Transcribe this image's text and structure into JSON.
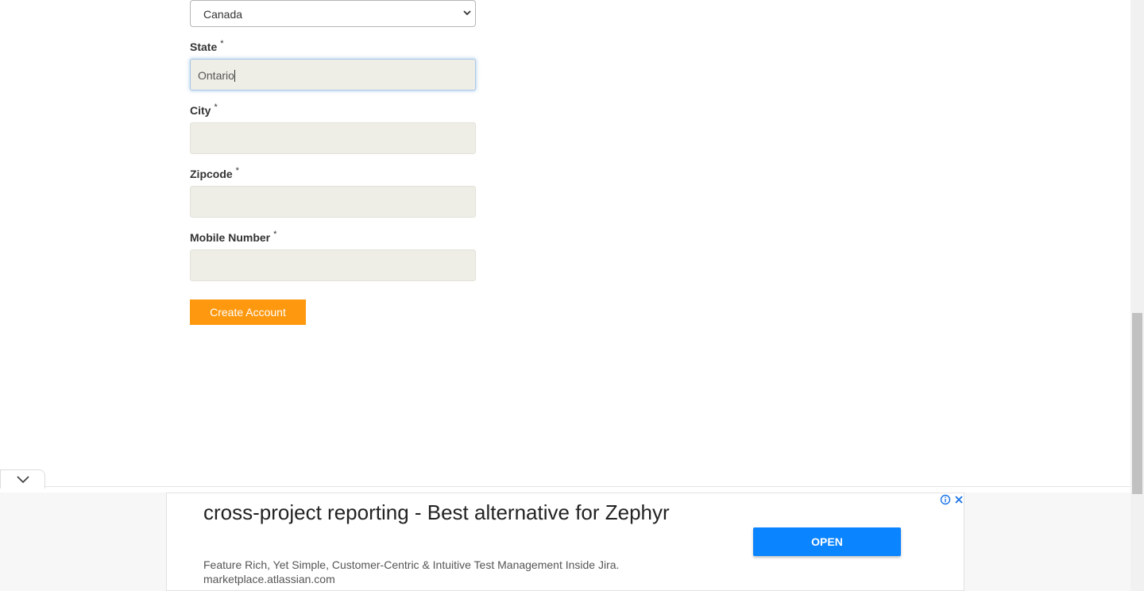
{
  "form": {
    "country_value": "Canada",
    "state_label": "State",
    "state_value": "Ontario",
    "city_label": "City",
    "city_value": "",
    "zipcode_label": "Zipcode",
    "zipcode_value": "",
    "mobile_label": "Mobile Number",
    "mobile_value": "",
    "required_mark": "*",
    "submit_label": "Create Account"
  },
  "ad": {
    "headline": "cross-project reporting - Best alternative for Zephyr",
    "description": "Feature Rich, Yet Simple, Customer-Centric & Intuitive Test Management Inside Jira.",
    "url": "marketplace.atlassian.com",
    "cta_label": "OPEN"
  },
  "colors": {
    "accent": "#fe980f",
    "ad_cta": "#0a84ff",
    "input_bg": "#eeede6"
  },
  "icons": [
    "chevron-down-icon",
    "info-icon",
    "close-icon"
  ]
}
